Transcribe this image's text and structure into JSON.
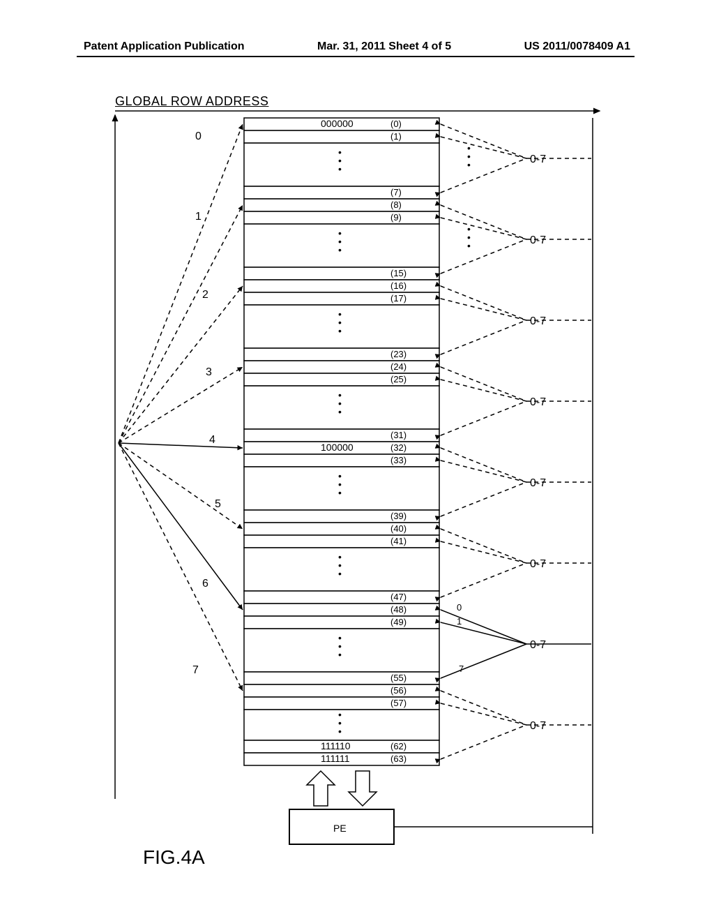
{
  "header": {
    "left": "Patent Application Publication",
    "center": "Mar. 31, 2011   Sheet 4 of 5",
    "right": "US 2011/0078409 A1"
  },
  "diagram": {
    "title": "GLOBAL ROW ADDRESS",
    "fig_label": "FIG.4A",
    "pe_label": "PE",
    "left_group_labels": [
      "0",
      "1",
      "2",
      "3",
      "4",
      "5",
      "6",
      "7"
    ],
    "right_range_label": "0-7",
    "right_small_labels": [
      "0",
      "1",
      "7"
    ],
    "binary_labels": {
      "row0": "000000",
      "row32": "100000",
      "row62": "111110",
      "row63": "111111"
    },
    "row_indices": {
      "g0": [
        "(0)",
        "(1)",
        "(7)"
      ],
      "g1": [
        "(8)",
        "(9)",
        "(15)"
      ],
      "g2": [
        "(16)",
        "(17)",
        "(23)"
      ],
      "g3": [
        "(24)",
        "(25)",
        "(31)"
      ],
      "g4": [
        "(32)",
        "(33)",
        "(39)"
      ],
      "g5": [
        "(40)",
        "(41)",
        "(47)"
      ],
      "g6": [
        "(48)",
        "(49)",
        "(55)"
      ],
      "g7": [
        "(56)",
        "(57)",
        "(62)",
        "(63)"
      ]
    }
  }
}
